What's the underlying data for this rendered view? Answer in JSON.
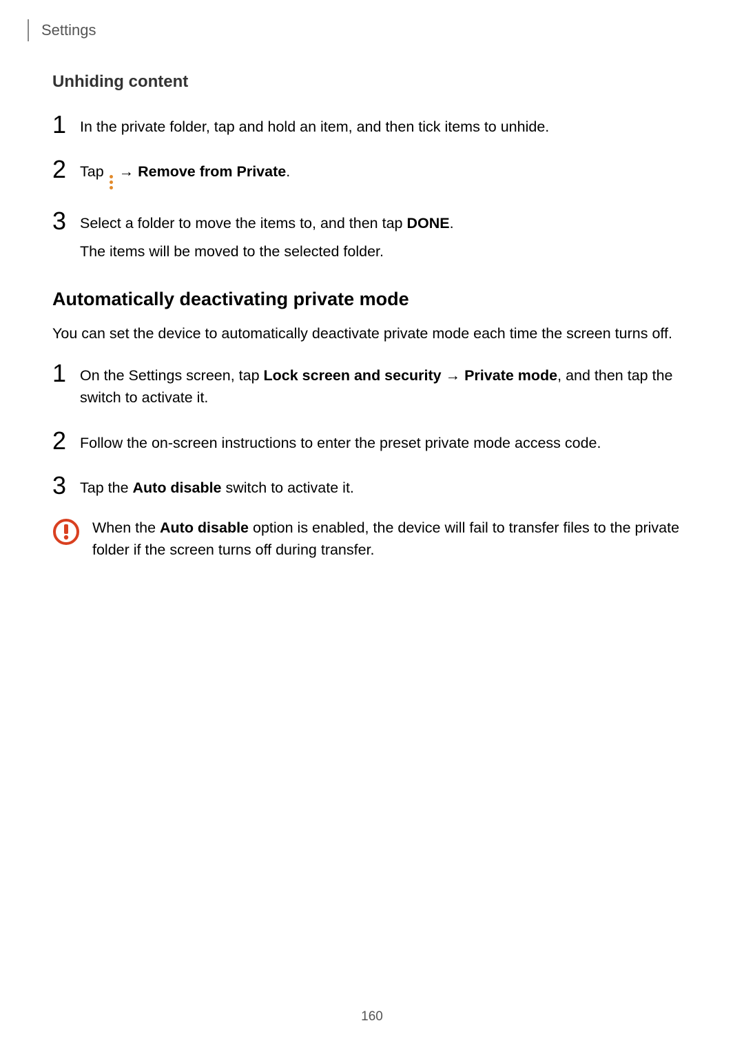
{
  "header": {
    "label": "Settings"
  },
  "section1": {
    "heading": "Unhiding content",
    "step1": {
      "num": "1",
      "text": "In the private folder, tap and hold an item, and then tick items to unhide."
    },
    "step2": {
      "num": "2",
      "pre": "Tap ",
      "arrow": " → ",
      "bold": "Remove from Private",
      "post": "."
    },
    "step3": {
      "num": "3",
      "line1_pre": "Select a folder to move the items to, and then tap ",
      "line1_bold": "DONE",
      "line1_post": ".",
      "line2": "The items will be moved to the selected folder."
    }
  },
  "section2": {
    "heading": "Automatically deactivating private mode",
    "intro": "You can set the device to automatically deactivate private mode each time the screen turns off.",
    "step1": {
      "num": "1",
      "pre": "On the Settings screen, tap ",
      "bold1": "Lock screen and security",
      "arrow": " → ",
      "bold2": "Private mode",
      "post": ", and then tap the switch to activate it."
    },
    "step2": {
      "num": "2",
      "text": "Follow the on-screen instructions to enter the preset private mode access code."
    },
    "step3": {
      "num": "3",
      "pre": "Tap the ",
      "bold": "Auto disable",
      "post": " switch to activate it."
    },
    "callout": {
      "pre": "When the ",
      "bold": "Auto disable",
      "post": " option is enabled, the device will fail to transfer files to the private folder if the screen turns off during transfer."
    }
  },
  "pageNumber": "160"
}
